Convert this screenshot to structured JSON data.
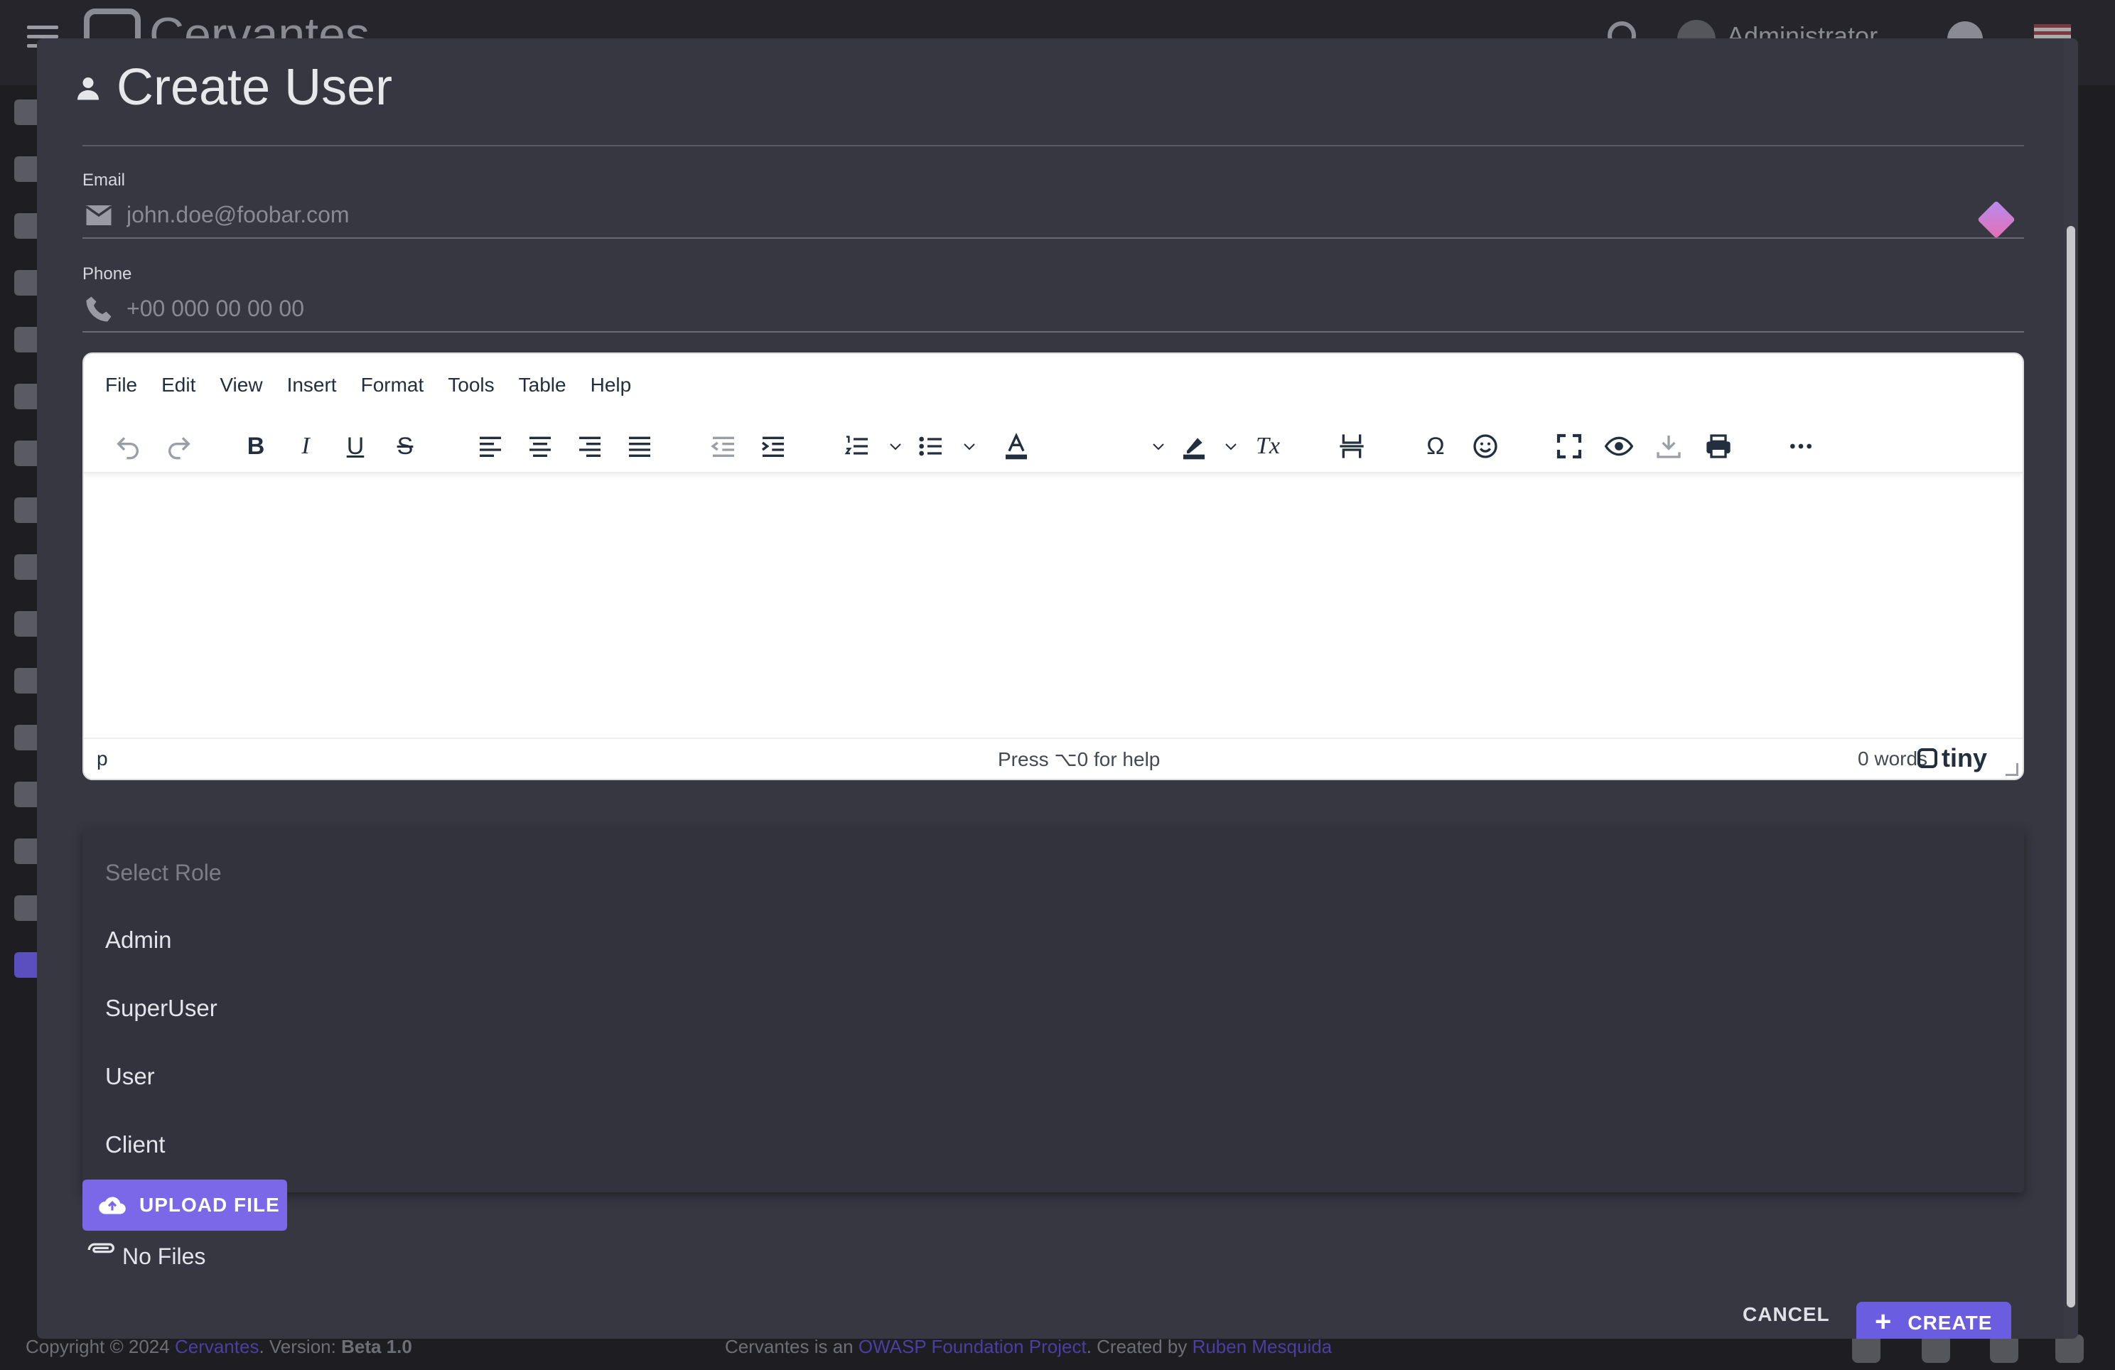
{
  "app": {
    "brand": "Cervantes",
    "user_name": "Administrator"
  },
  "footer": {
    "copyright": "Copyright © 2024 ",
    "brand_link": "Cervantes",
    "version_label": ". Version: ",
    "version": "Beta 1.0",
    "project_prefix": "Cervantes is an ",
    "project_link": "OWASP Foundation Project",
    "created_by": ". Created by ",
    "author_link": "Ruben Mesquida"
  },
  "dialog": {
    "title": "Create User",
    "email": {
      "label": "Email",
      "value": "",
      "placeholder": "john.doe@foobar.com"
    },
    "phone": {
      "label": "Phone",
      "value": "",
      "placeholder": "+00 000 00 00 00"
    },
    "editor": {
      "menu": [
        "File",
        "Edit",
        "View",
        "Insert",
        "Format",
        "Tools",
        "Table",
        "Help"
      ],
      "path": "p",
      "help": "Press ⌥0 for help",
      "word_count": "0 words",
      "brand": "tiny"
    },
    "role": {
      "placeholder": "Select Role",
      "options": [
        "Admin",
        "SuperUser",
        "User",
        "Client"
      ]
    },
    "upload_label": "UPLOAD FILE",
    "files_status": "No Files",
    "cancel_label": "CANCEL",
    "create_label": "CREATE"
  },
  "colors": {
    "accent": "#7b68e8",
    "dialog_bg": "#373741",
    "dropdown_bg": "#33333d"
  }
}
